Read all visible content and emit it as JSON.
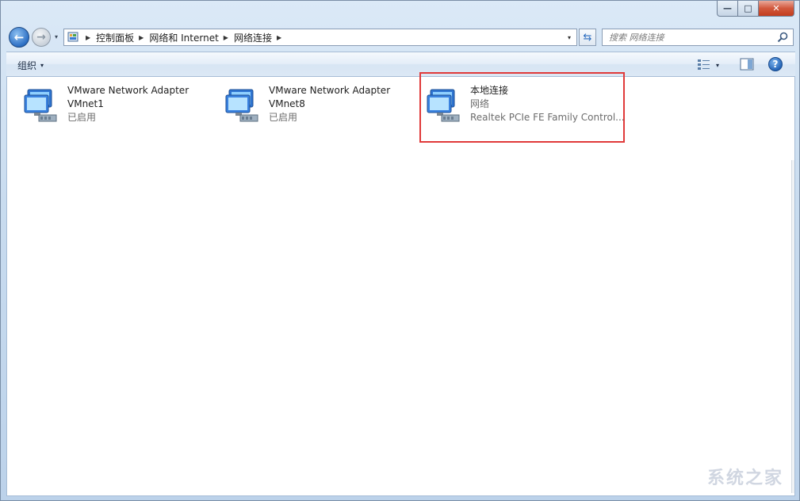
{
  "window": {
    "caption": {
      "minimize": "—",
      "maximize": "□",
      "close": "✕"
    }
  },
  "nav": {
    "back": "←",
    "forward": "→",
    "recent": "▾",
    "breadcrumb": [
      "控制面板",
      "网络和 Internet",
      "网络连接"
    ],
    "address_dropdown": "▾",
    "refresh": "⇆",
    "search_placeholder": "搜索 网络连接"
  },
  "toolbar": {
    "organize": "组织",
    "organize_arrow": "▾",
    "view_arrow": "▾",
    "help": "?"
  },
  "adapters": [
    {
      "name": "VMware Network Adapter",
      "line2": "VMnet1",
      "line3": "已启用"
    },
    {
      "name": "VMware Network Adapter",
      "line2": "VMnet8",
      "line3": "已启用"
    },
    {
      "name": "本地连接",
      "line2": "网络",
      "line3": "Realtek PCIe FE Family Control..."
    }
  ],
  "watermark": "系统之家",
  "colors": {
    "highlight": "#e03a3a",
    "accent": "#2d6fc4"
  }
}
